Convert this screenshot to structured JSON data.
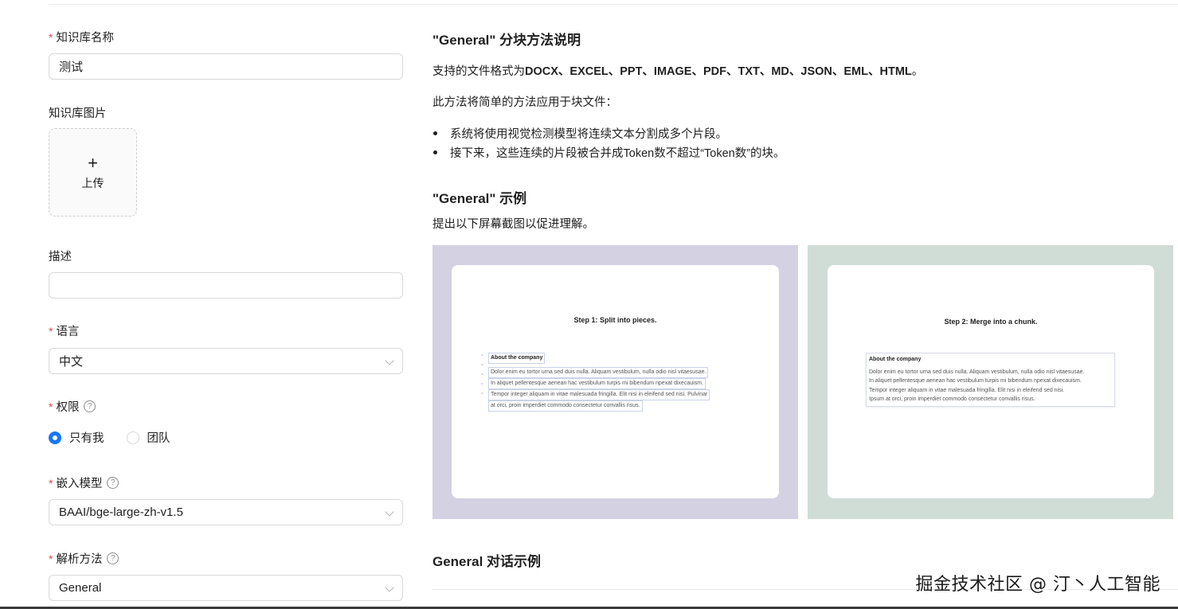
{
  "form": {
    "kb_name": {
      "label": "知识库名称",
      "value": "测试"
    },
    "kb_image": {
      "label": "知识库图片",
      "upload_label": "上传"
    },
    "description": {
      "label": "描述",
      "value": ""
    },
    "language": {
      "label": "语言",
      "value": "中文"
    },
    "permission": {
      "label": "权限",
      "options": [
        "只有我",
        "团队"
      ],
      "selected": "只有我"
    },
    "embedding_model": {
      "label": "嵌入模型",
      "value": "BAAI/bge-large-zh-v1.5"
    },
    "parse_method": {
      "label": "解析方法",
      "value": "General"
    },
    "required_mark": "*",
    "help_glyph": "?",
    "plus_glyph": "+"
  },
  "doc": {
    "method_heading": "\"General\" 分块方法说明",
    "formats_prefix": "支持的文件格式为",
    "formats_list": "DOCX、EXCEL、PPT、IMAGE、PDF、TXT、MD、JSON、EML、HTML",
    "formats_suffix": "。",
    "method_intro": "此方法将简单的方法应用于块文件：",
    "bullets": [
      "系统将使用视觉检测模型将连续文本分割成多个片段。",
      "接下来，这些连续的片段被合并成Token数不超过“Token数”的块。"
    ],
    "example_heading": "\"General\" 示例",
    "example_intro": "提出以下屏幕截图以促进理解。",
    "step1": {
      "title": "Step 1: Split into pieces.",
      "doc_title": "About the company",
      "lines": [
        "Dolor enim eu tortor urna sed duis nulla. Aliquam vestibulum, nulla odio nisl vitaesusae.",
        "In aliquet pellentesque aenean hac vestibulum turpis mi bibendum npexat dixecauism.",
        "Tempor integer aliquam in vitae malesuada fringilla. Elit nisi in eleifend sed nisi. Pulvinar",
        "at orci, proin imperdiet commodo consectetur convallis risus."
      ]
    },
    "step2": {
      "title": "Step 2: Merge into a chunk.",
      "doc_title": "About the company",
      "lines": [
        "Dolor enim eu tortor urna sed duis nulla. Aliquam vestibulum, nulla odio nisl vitaesusae.",
        "In aliquet pellentesque aenean hac vestibulum turpis mi bibendum npexat dixecauism.",
        "Tempor integer aliquam in vitae malesuada fringilla. Elit nisi in eleifend sed nisi.",
        "Ipsum at orci, proin imperdiet commodo consectetur convallis risus."
      ]
    },
    "chat_heading": "General 对话示例"
  },
  "watermark": "掘金技术社区 @ 汀丶人工智能",
  "colors": {
    "accent": "#1677ff",
    "required": "#e5484d",
    "panel1_bg": "#d3d1e2",
    "panel2_bg": "#d0ddd7"
  }
}
